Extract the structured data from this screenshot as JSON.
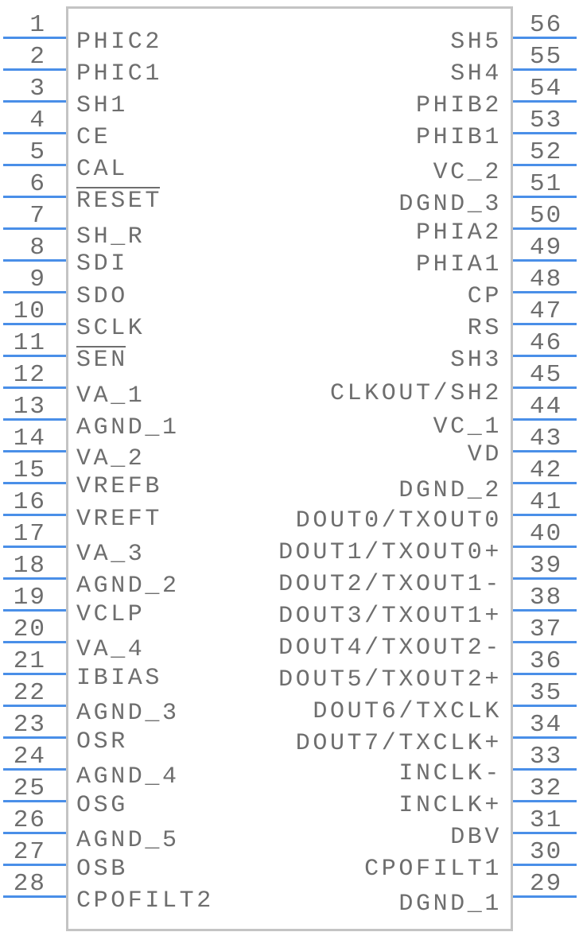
{
  "component": {
    "type": "IC schematic symbol",
    "pin_count": 56,
    "colors": {
      "pin_line": "#4a8fe8",
      "body_border": "#c4c4c4",
      "text": "#6e6e6e"
    }
  },
  "left_pins": [
    {
      "number": "1",
      "label": "PHIC2"
    },
    {
      "number": "2",
      "label": "PHIC1"
    },
    {
      "number": "3",
      "label": "SH1"
    },
    {
      "number": "4",
      "label": "CE"
    },
    {
      "number": "5",
      "label": "CAL"
    },
    {
      "number": "6",
      "label": "RESET",
      "overline": true
    },
    {
      "number": "7",
      "label": "SH_R"
    },
    {
      "number": "8",
      "label": "SDI"
    },
    {
      "number": "9",
      "label": "SDO"
    },
    {
      "number": "10",
      "label": "SCLK"
    },
    {
      "number": "11",
      "label": "SEN",
      "overline": true
    },
    {
      "number": "12",
      "label": "VA_1"
    },
    {
      "number": "13",
      "label": "AGND_1"
    },
    {
      "number": "14",
      "label": "VA_2"
    },
    {
      "number": "15",
      "label": "VREFB"
    },
    {
      "number": "16",
      "label": "VREFT"
    },
    {
      "number": "17",
      "label": "VA_3"
    },
    {
      "number": "18",
      "label": "AGND_2"
    },
    {
      "number": "19",
      "label": "VCLP"
    },
    {
      "number": "20",
      "label": "VA_4"
    },
    {
      "number": "21",
      "label": "IBIAS"
    },
    {
      "number": "22",
      "label": "AGND_3"
    },
    {
      "number": "23",
      "label": "OSR"
    },
    {
      "number": "24",
      "label": "AGND_4"
    },
    {
      "number": "25",
      "label": "OSG"
    },
    {
      "number": "26",
      "label": "AGND_5"
    },
    {
      "number": "27",
      "label": "OSB"
    },
    {
      "number": "28",
      "label": "CPOFILT2"
    }
  ],
  "right_pins": [
    {
      "number": "56",
      "label": "SH5"
    },
    {
      "number": "55",
      "label": "SH4"
    },
    {
      "number": "54",
      "label": "PHIB2"
    },
    {
      "number": "53",
      "label": "PHIB1"
    },
    {
      "number": "52",
      "label": "VC_2"
    },
    {
      "number": "51",
      "label": "DGND_3"
    },
    {
      "number": "50",
      "label": "PHIA2"
    },
    {
      "number": "49",
      "label": "PHIA1"
    },
    {
      "number": "48",
      "label": "CP"
    },
    {
      "number": "47",
      "label": "RS"
    },
    {
      "number": "46",
      "label": "SH3"
    },
    {
      "number": "45",
      "label": "CLKOUT/SH2"
    },
    {
      "number": "44",
      "label": "VC_1"
    },
    {
      "number": "43",
      "label": "VD"
    },
    {
      "number": "42",
      "label": "DGND_2"
    },
    {
      "number": "41",
      "label": "DOUT0/TXOUT0"
    },
    {
      "number": "40",
      "label": "DOUT1/TXOUT0+"
    },
    {
      "number": "39",
      "label": "DOUT2/TXOUT1-"
    },
    {
      "number": "38",
      "label": "DOUT3/TXOUT1+"
    },
    {
      "number": "37",
      "label": "DOUT4/TXOUT2-"
    },
    {
      "number": "36",
      "label": "DOUT5/TXOUT2+"
    },
    {
      "number": "35",
      "label": "DOUT6/TXCLK"
    },
    {
      "number": "34",
      "label": "DOUT7/TXCLK+"
    },
    {
      "number": "33",
      "label": "INCLK-"
    },
    {
      "number": "32",
      "label": "INCLK+"
    },
    {
      "number": "31",
      "label": "DBV"
    },
    {
      "number": "30",
      "label": "CPOFILT1"
    },
    {
      "number": "29",
      "label": "DGND_1"
    }
  ]
}
